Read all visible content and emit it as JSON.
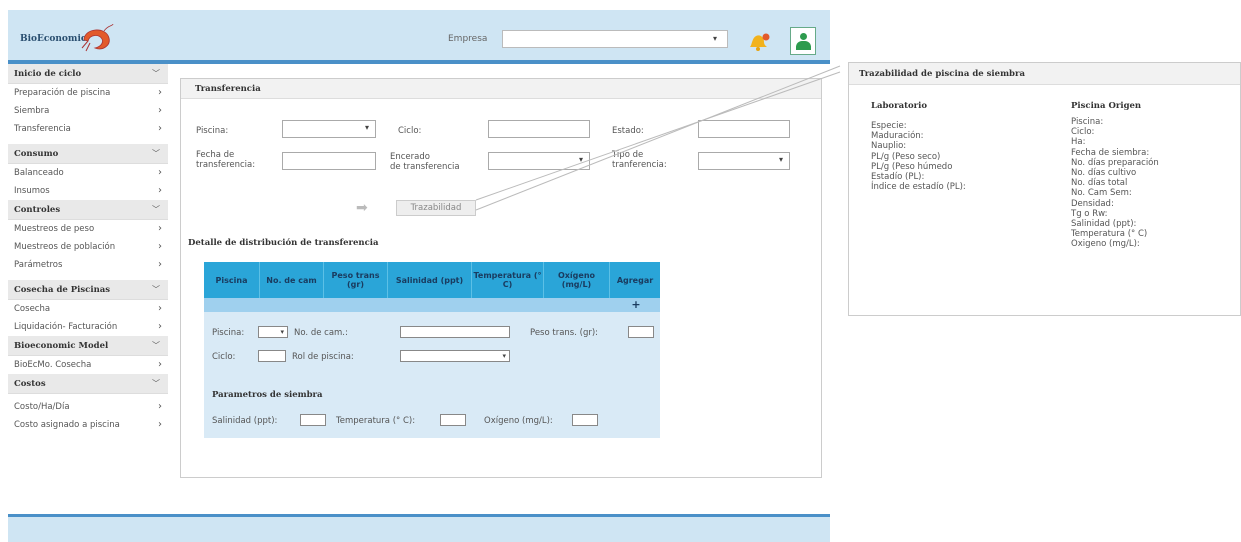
{
  "header": {
    "logo_text": "BioEconomic",
    "empresa_label": "Empresa",
    "empresa_value": ""
  },
  "sidebar": {
    "sections": [
      {
        "title": "Inicio de ciclo",
        "items": [
          "Preparación de piscina",
          "Siembra",
          "Transferencia"
        ]
      },
      {
        "title": "Consumo",
        "items": [
          "Balanceado",
          "Insumos"
        ]
      },
      {
        "title": "Controles",
        "items": [
          "Muestreos de peso",
          "Muestreos de población",
          "Parámetros"
        ]
      },
      {
        "title": "Cosecha de Piscinas",
        "items": [
          "Cosecha",
          "Liquidación- Facturación"
        ]
      },
      {
        "title": "Bioeconomic Model",
        "items": [
          "BioEcMo. Cosecha"
        ]
      },
      {
        "title": "Costos",
        "items": [
          "Costo/Ha/Día",
          "Costo asignado a piscina"
        ]
      }
    ]
  },
  "transfer": {
    "title": "Transferencia",
    "piscina_label": "Piscina:",
    "ciclo_label": "Ciclo:",
    "estado_label": "Estado:",
    "fecha_label_1": "Fecha de",
    "fecha_label_2": "transferencia:",
    "encerado_label_1": "Encerado",
    "encerado_label_2": "de transferencia",
    "tipo_label_1": "Tipo de",
    "tipo_label_2": "tranferencia:",
    "traz_button": "Trazabilidad",
    "detail_title": "Detalle de distribución de transferencia"
  },
  "grid": {
    "headers": [
      "Piscina",
      "No. de cam",
      "Peso trans (gr)",
      "Salinidad (ppt)",
      "Temperatura (° C)",
      "Oxígeno (mg/L)",
      "Agregar"
    ],
    "add_symbol": "+",
    "form": {
      "piscina": "Piscina:",
      "no_cam": "No. de cam.:",
      "peso_trans": "Peso trans. (gr):",
      "ciclo": "Ciclo:",
      "rol": "Rol de piscina:",
      "params_title": "Parametros de siembra",
      "salinidad": "Salinidad (ppt):",
      "temperatura": "Temperatura (° C):",
      "oxigeno": "Oxígeno (mg/L):"
    }
  },
  "trace_panel": {
    "title": "Trazabilidad de piscina de siembra",
    "lab_title": "Laboratorio",
    "lab_lines": [
      "Especie:",
      "Maduración:",
      "Nauplio:",
      "PL/g (Peso seco)",
      "PL/g (Peso húmedo",
      "Estadío (PL):",
      "Índice de estadío (PL):"
    ],
    "origin_title": "Piscina Origen",
    "origin_lines": [
      "Piscina:",
      "Ciclo:",
      "Ha:",
      "Fecha de siembra:",
      "No. días preparación",
      "No. días cultivo",
      "No. días total",
      "No. Cam Sem:",
      "Densidad:",
      "Tg o Rw:",
      "Salinidad (ppt):",
      "Temperatura (° C)",
      "Oxigeno (mg/L):"
    ]
  },
  "colors": {
    "accent": "#2aa5d8",
    "header_bg": "#cfe5f3",
    "header_border": "#4a90c8",
    "icon_green": "#2d9b4e"
  }
}
